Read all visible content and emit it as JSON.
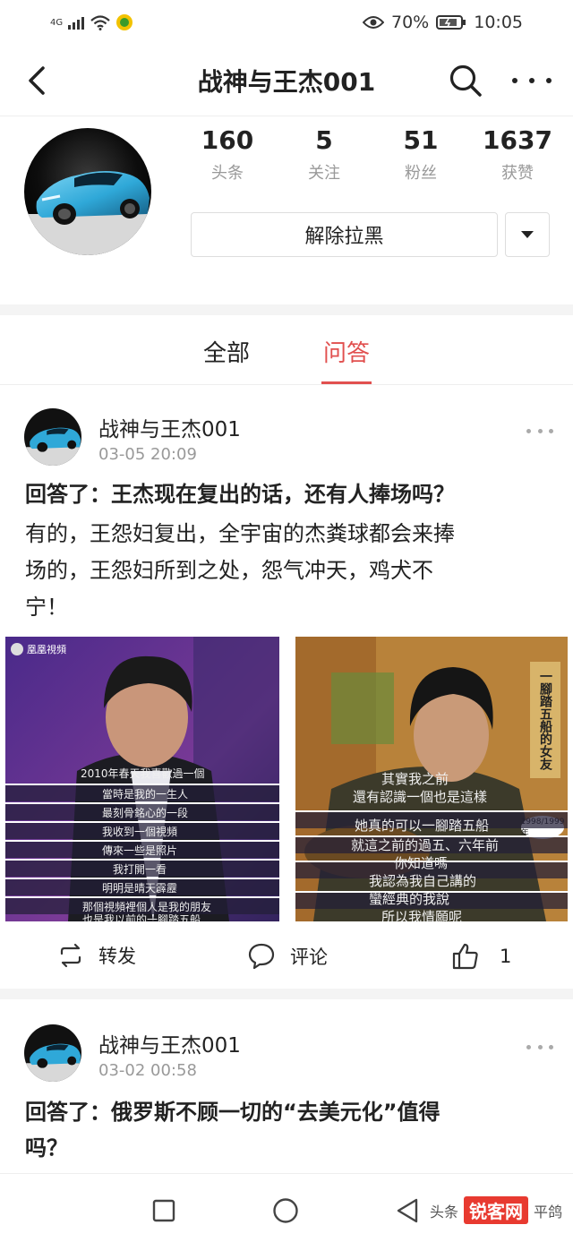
{
  "status": {
    "network": "4G",
    "battery": "70%",
    "time": "10:05"
  },
  "header": {
    "title": "战神与王杰001"
  },
  "profile": {
    "stats": [
      {
        "value": "160",
        "label": "头条"
      },
      {
        "value": "5",
        "label": "关注"
      },
      {
        "value": "51",
        "label": "粉丝"
      },
      {
        "value": "1637",
        "label": "获赞"
      }
    ],
    "unblock_label": "解除拉黑"
  },
  "tabs": [
    {
      "label": "全部",
      "active": false
    },
    {
      "label": "问答",
      "active": true
    }
  ],
  "posts": [
    {
      "author": "战神与王杰001",
      "time": "03-05 20:09",
      "question": "回答了：王杰现在复出的话，还有人捧场吗？",
      "answer_lines": [
        "有的，王怨妇复出，全宇宙的杰粪球都会来捧",
        "场的，王怨妇所到之处，怨气冲天，鸡犬不",
        "宁！"
      ],
      "image_left": {
        "logo": "凰凰視頻",
        "subtitles": [
          "2010年春天我喜歡過一個",
          "當時是我的一生人",
          "最刻骨銘心的一段",
          "我收到一個視頻",
          "傳來一些是照片",
          "我打開一看",
          "明明是晴天霹靂",
          "那個視頻裡個人是我的朋友",
          "也是我以前的一腳踏五船"
        ]
      },
      "image_right": {
        "top_text": "一腳踏五船的女友",
        "badge": "1998/1999年",
        "subtitles": [
          "其實我之前",
          "還有認識一個也是這樣",
          "她真的可以一腳踏五船",
          "就這之前的過五、六年前",
          "你知道嗎",
          "我認為我自己講的",
          "蠻經典的我說",
          "所以我情願呢"
        ]
      },
      "actions": {
        "share": "转发",
        "comment": "评论",
        "likes": "1"
      }
    },
    {
      "author": "战神与王杰001",
      "time": "03-02 00:58",
      "question_lines": [
        "回答了：俄罗斯不顾一切的“去美元化”值得",
        "吗？"
      ]
    }
  ],
  "watermark": {
    "prefix": "头条",
    "brand": "锐客网",
    "suffix": "平鸽"
  },
  "colors": {
    "accent": "#e1504f",
    "car_blue": "#2fa8d8"
  }
}
